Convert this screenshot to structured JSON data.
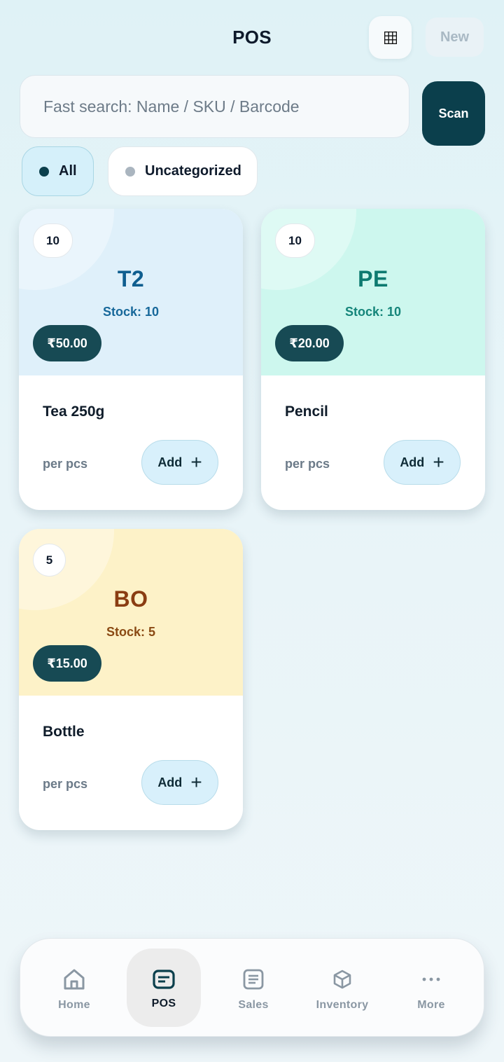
{
  "header": {
    "title": "POS",
    "new_label": "New"
  },
  "search": {
    "placeholder": "Fast search: Name / SKU / Barcode",
    "value": "",
    "scan_label": "Scan"
  },
  "filters": [
    {
      "label": "All",
      "selected": true
    },
    {
      "label": "Uncategorized",
      "selected": false
    }
  ],
  "products": [
    {
      "badge": "10",
      "code": "T2",
      "stock": "Stock: 10",
      "price": "₹50.00",
      "name": "Tea 250g",
      "unit": "per pcs",
      "add_label": "Add",
      "accent": "#dff0fa"
    },
    {
      "badge": "10",
      "code": "PE",
      "stock": "Stock: 10",
      "price": "₹20.00",
      "name": "Pencil",
      "unit": "per pcs",
      "add_label": "Add",
      "accent": "#cdf7ee"
    },
    {
      "badge": "5",
      "code": "BO",
      "stock": "Stock: 5",
      "price": "₹15.00",
      "name": "Bottle",
      "unit": "per pcs",
      "add_label": "Add",
      "accent": "#fdf2c8"
    }
  ],
  "nav": [
    {
      "label": "Home",
      "icon": "home-icon",
      "active": false
    },
    {
      "label": "POS",
      "icon": "pos-icon",
      "active": true
    },
    {
      "label": "Sales",
      "icon": "sales-icon",
      "active": false
    },
    {
      "label": "Inventory",
      "icon": "inventory-icon",
      "active": false
    },
    {
      "label": "More",
      "icon": "more-icon",
      "active": false
    }
  ],
  "colors": {
    "primary": "#0b3f4c",
    "price_pill": "#174a54",
    "add_button": "#d8f0fb"
  }
}
